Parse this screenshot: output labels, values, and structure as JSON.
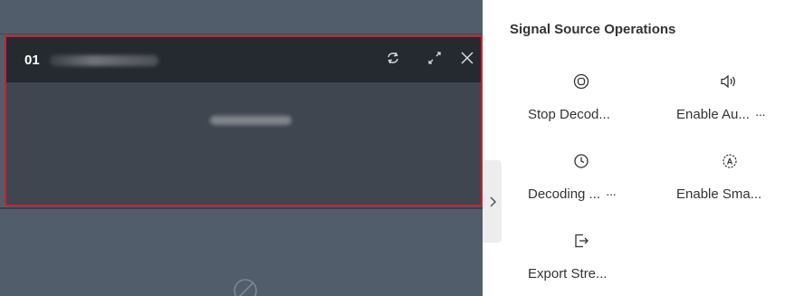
{
  "window": {
    "index": "01",
    "icons": [
      "refresh-icon",
      "fullscreen-icon",
      "close-icon"
    ]
  },
  "panel": {
    "title": "Signal Source Operations",
    "operations": [
      {
        "label": "Stop Decod...",
        "icon": "stop-circle-icon",
        "more": ""
      },
      {
        "label": "Enable Au...",
        "icon": "speaker-icon",
        "more": "···"
      },
      {
        "label": "Decoding ...",
        "icon": "clock-icon",
        "more": "···"
      },
      {
        "label": "Enable Sma...",
        "icon": "auto-a-icon",
        "more": ""
      },
      {
        "label": "Export Stre...",
        "icon": "export-icon",
        "more": ""
      }
    ]
  },
  "colors": {
    "accent_border": "#c9232b",
    "wall_bg": "#525d6c",
    "window_header_bg": "#252a31"
  }
}
